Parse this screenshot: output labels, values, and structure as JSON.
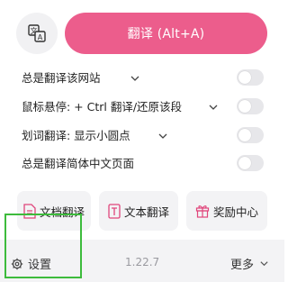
{
  "header": {
    "lang_icon": "language-switch-icon",
    "translate_label": "翻译 (Alt+A)",
    "accent": "#ec5d8c"
  },
  "options": [
    {
      "label": "总是翻译该网站",
      "has_dropdown": true,
      "enabled": false
    },
    {
      "label": "鼠标悬停:  + Ctrl 翻译/还原该段",
      "has_dropdown": true,
      "enabled": false
    },
    {
      "label": "划词翻译:  显示小圆点",
      "has_dropdown": true,
      "enabled": false
    },
    {
      "label": "总是翻译简体中文页面",
      "has_dropdown": false,
      "enabled": false
    }
  ],
  "tools": [
    {
      "label": "文档翻译",
      "icon": "document-icon"
    },
    {
      "label": "文本翻译",
      "icon": "text-t-icon"
    },
    {
      "label": "奖励中心",
      "icon": "gift-icon"
    }
  ],
  "footer": {
    "settings_label": "设置",
    "version": "1.22.7",
    "more_label": "更多",
    "highlight_color": "#3dbb3c"
  }
}
